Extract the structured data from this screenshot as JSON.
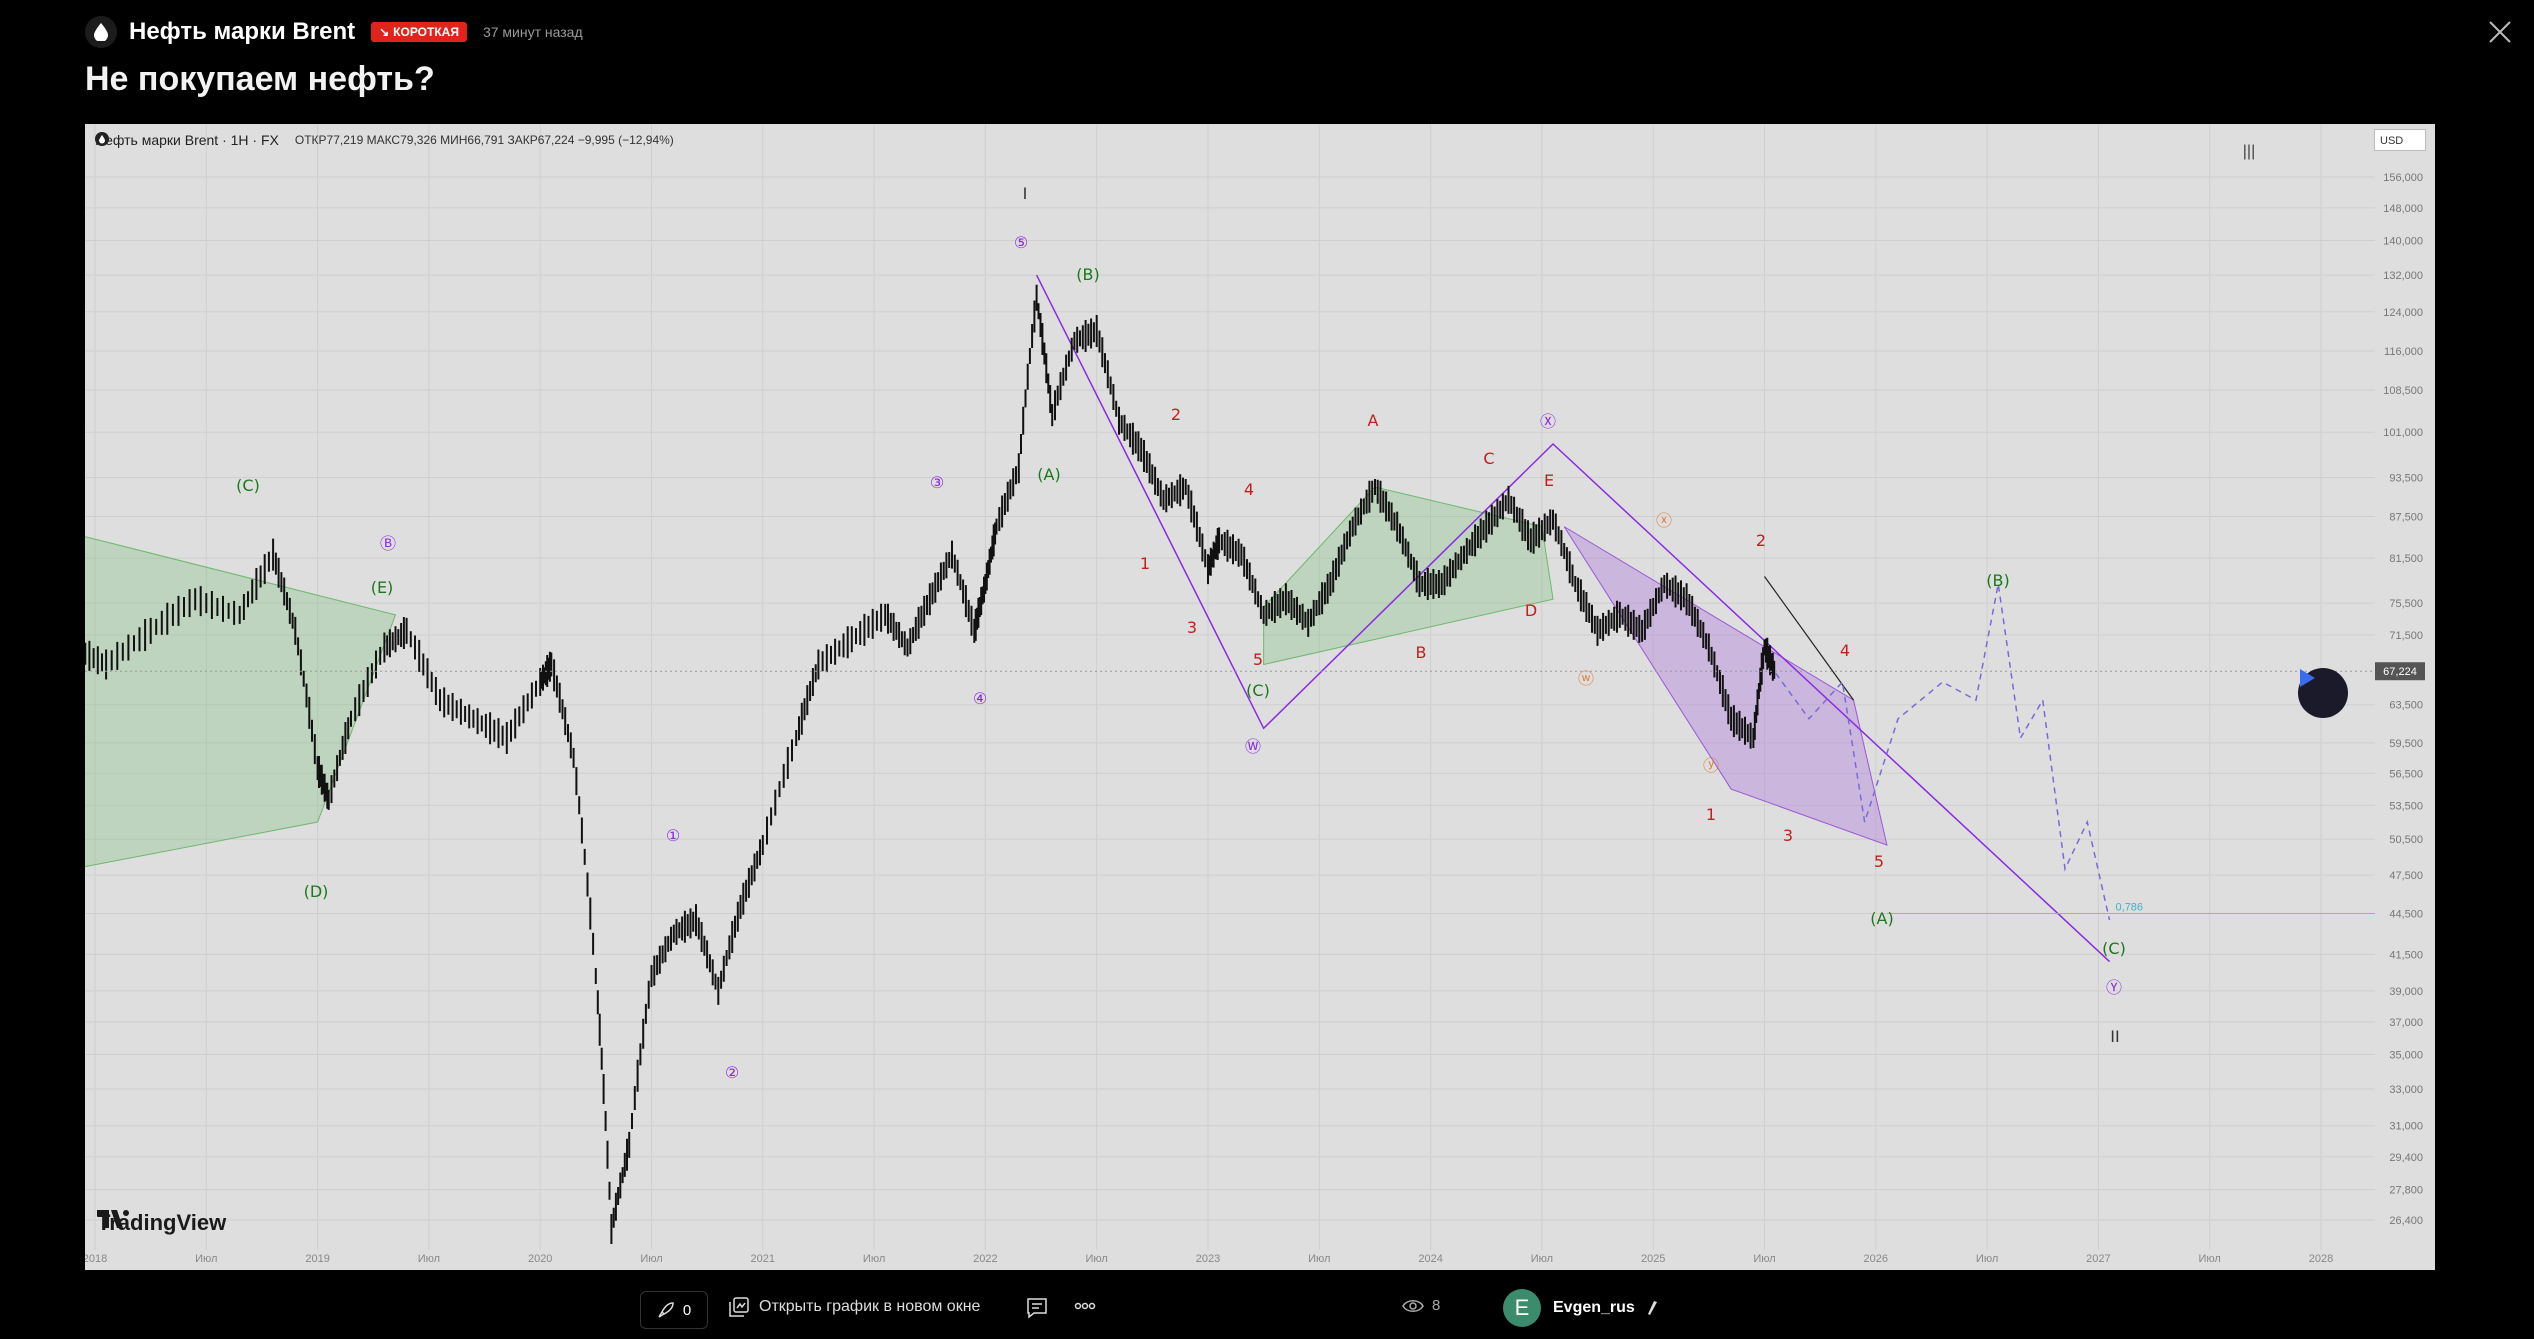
{
  "header": {
    "symbol": "Нефть марки Brent",
    "badge": "КОРОТКАЯ",
    "time_ago": "37 минут назад",
    "title": "Не покупаем нефть?"
  },
  "chart_legend": {
    "symbol_line": "Нефть марки Brent · 1H · FX",
    "ohlc": "ОТКР77,219  МАКС79,326  МИН66,791  ЗАКР67,224  −9,995 (−12,94%)",
    "currency": "USD",
    "toolbar_glyph": "|||"
  },
  "brand": "TradingView",
  "chart_data": {
    "type": "line",
    "price_axis": [
      "156,000",
      "148,000",
      "140,000",
      "132,000",
      "124,000",
      "116,000",
      "108,500",
      "101,000",
      "93,500",
      "87,500",
      "81,500",
      "75,500",
      "71,500",
      "63,500",
      "59,500",
      "56,500",
      "53,500",
      "50,500",
      "47,500",
      "44,500",
      "41,500",
      "39,000",
      "37,000",
      "35,000",
      "33,000",
      "31,000",
      "29,400",
      "27,800",
      "26,400"
    ],
    "time_axis": [
      "2018",
      "Июл",
      "2019",
      "Июл",
      "2020",
      "Июл",
      "2021",
      "Июл",
      "2022",
      "Июл",
      "2023",
      "Июл",
      "2024",
      "Июл",
      "2025",
      "Июл",
      "2026",
      "Июл",
      "2027",
      "Июл",
      "2028"
    ],
    "last_price": "67,224",
    "fib_label": "0,786",
    "annotations": [
      "I",
      "⑤",
      "(B)",
      "(A)",
      "③",
      "④",
      "①",
      "②",
      "(C)",
      "Ⓑ",
      "(E)",
      "(D)",
      "1",
      "2",
      "3",
      "4",
      "5",
      "(C)",
      "Ⓦ",
      "A",
      "B",
      "C",
      "D",
      "E",
      "Ⓧ",
      "ⓧ",
      "ⓦ",
      "ⓨ",
      "1",
      "2",
      "3",
      "4",
      "5",
      "(A)",
      "(B)",
      "(C)",
      "Ⓨ",
      "II"
    ],
    "price_path": [
      [
        2017.85,
        70
      ],
      [
        2018.0,
        68
      ],
      [
        2018.2,
        72
      ],
      [
        2018.4,
        76
      ],
      [
        2018.6,
        74
      ],
      [
        2018.75,
        82
      ],
      [
        2018.85,
        72
      ],
      [
        2018.95,
        57
      ],
      [
        2019.0,
        54
      ],
      [
        2019.1,
        62
      ],
      [
        2019.25,
        70
      ],
      [
        2019.35,
        72
      ],
      [
        2019.5,
        64
      ],
      [
        2019.65,
        62
      ],
      [
        2019.8,
        60
      ],
      [
        2019.95,
        66
      ],
      [
        2020.0,
        68
      ],
      [
        2020.1,
        58
      ],
      [
        2020.2,
        40
      ],
      [
        2020.27,
        26
      ],
      [
        2020.35,
        30
      ],
      [
        2020.45,
        40
      ],
      [
        2020.55,
        43
      ],
      [
        2020.65,
        44
      ],
      [
        2020.75,
        39
      ],
      [
        2020.85,
        45
      ],
      [
        2020.95,
        50
      ],
      [
        2021.1,
        60
      ],
      [
        2021.2,
        68
      ],
      [
        2021.35,
        71
      ],
      [
        2021.5,
        74
      ],
      [
        2021.6,
        70
      ],
      [
        2021.7,
        76
      ],
      [
        2021.8,
        82
      ],
      [
        2021.9,
        72
      ],
      [
        2021.95,
        78
      ],
      [
        2022.0,
        86
      ],
      [
        2022.1,
        95
      ],
      [
        2022.18,
        127
      ],
      [
        2022.25,
        104
      ],
      [
        2022.35,
        118
      ],
      [
        2022.45,
        120
      ],
      [
        2022.55,
        103
      ],
      [
        2022.65,
        98
      ],
      [
        2022.75,
        90
      ],
      [
        2022.85,
        92
      ],
      [
        2022.95,
        80
      ],
      [
        2023.0,
        84
      ],
      [
        2023.1,
        82
      ],
      [
        2023.2,
        74
      ],
      [
        2023.3,
        76
      ],
      [
        2023.4,
        73
      ],
      [
        2023.5,
        78
      ],
      [
        2023.6,
        86
      ],
      [
        2023.7,
        92
      ],
      [
        2023.8,
        86
      ],
      [
        2023.9,
        78
      ],
      [
        2024.0,
        78
      ],
      [
        2024.1,
        82
      ],
      [
        2024.2,
        86
      ],
      [
        2024.3,
        90
      ],
      [
        2024.4,
        84
      ],
      [
        2024.5,
        87
      ],
      [
        2024.6,
        78
      ],
      [
        2024.7,
        72
      ],
      [
        2024.8,
        74
      ],
      [
        2024.9,
        72
      ],
      [
        2025.0,
        78
      ],
      [
        2025.1,
        76
      ],
      [
        2025.2,
        70
      ],
      [
        2025.3,
        62
      ],
      [
        2025.4,
        60
      ],
      [
        2025.45,
        70
      ],
      [
        2025.5,
        67
      ]
    ],
    "forecast_path": [
      [
        2025.5,
        67
      ],
      [
        2025.65,
        62
      ],
      [
        2025.8,
        66
      ],
      [
        2025.9,
        52
      ],
      [
        2026.05,
        62
      ],
      [
        2026.25,
        66
      ],
      [
        2026.4,
        64
      ],
      [
        2026.5,
        78
      ],
      [
        2026.6,
        60
      ],
      [
        2026.7,
        64
      ],
      [
        2026.8,
        48
      ],
      [
        2026.9,
        52
      ],
      [
        2027.0,
        44
      ]
    ]
  },
  "footer": {
    "boost_count": "0",
    "open_chart": "Открыть график в новом окне",
    "views": "8",
    "author_initial": "E",
    "author": "Evgen_rus"
  }
}
